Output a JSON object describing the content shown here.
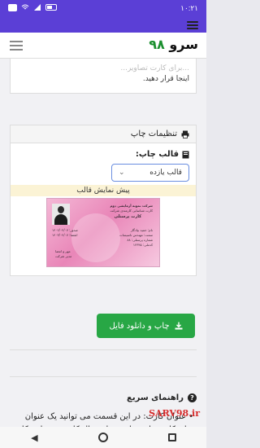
{
  "status_bar": {
    "time": "١٠:٢١",
    "icons": [
      "app-icon",
      "wifi-icon",
      "signal-icon",
      "battery-icon"
    ]
  },
  "header": {
    "logo_text": "سرو",
    "logo_number": "۹۸"
  },
  "intro_card": {
    "line_faded": "...برای کارت تصاویر...",
    "line2": "اینجا قرار دهید."
  },
  "print_settings": {
    "title": "تنظیمات چاپ",
    "template_label": "قالب چاپ:",
    "template_selected": "قالب یازده",
    "preview_label": "پیش نمایش قالب"
  },
  "id_card": {
    "company": "شرکت نمونه آزمایشی دوم",
    "subtitle": "کارت شناسایی کارمندی شرکت",
    "card_title": "کارت پرسنلی",
    "name": "نام: حمید بیادگار",
    "position": "سمت: مهندس تاسیسات",
    "personnel_no": "شماره پرسنلی: ۸۸",
    "code": "کدملی: ۱۲۳۴۵",
    "issue": "صدور: ۱۴۰۲/۰۲/۰۷",
    "expire": "انقضا: ۱۴۰۳/۰۲/۰۷",
    "sign": "مهر و امضا",
    "manager": "مدیر شرکت"
  },
  "download_button": {
    "label": "چاپ و دانلود فایل"
  },
  "guide": {
    "title": "راهنمای سریع",
    "text": "عنوان کارت: در این قسمت می توانید یک عنوان برای کارت وارد نمایید. برای مثال کارت پرسنلی، کارت شناسایی و غیره. این عنوان بزرگ"
  },
  "watermark": "SARV98.ir",
  "colors": {
    "status_bar": "#5b3fd6",
    "button_green": "#28a745",
    "preview_bg": "#fbf3d5",
    "card_pink": "#e986b8"
  }
}
